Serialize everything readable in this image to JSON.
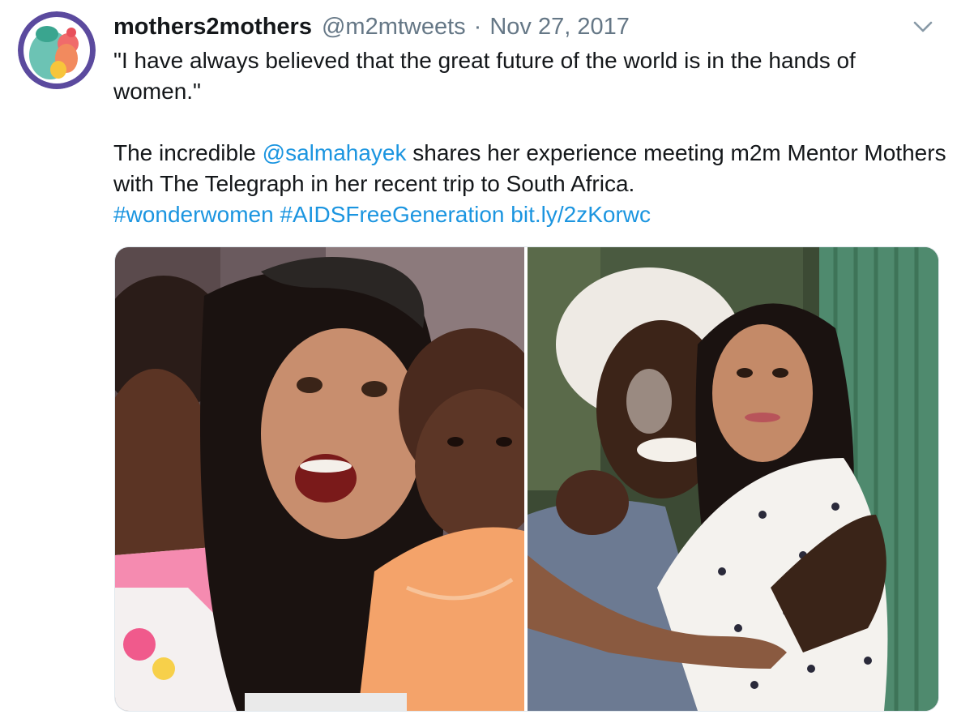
{
  "tweet": {
    "author": {
      "display_name": "mothers2mothers",
      "handle": "@m2mtweets",
      "avatar_icon": "mothers2mothers-logo"
    },
    "separator": "·",
    "date": "Nov 27, 2017",
    "menu_icon": "chevron-down-icon",
    "quote_line": "\"I have always believed that the great future of the world is in the hands of women.\"",
    "body": {
      "prefix": "The incredible ",
      "mention": "@salmahayek",
      "suffix": " shares her experience meeting m2m Mentor Mothers with The Telegraph in her recent trip to South Africa."
    },
    "hashtags": [
      "#wonderwomen",
      "#AIDSFreeGeneration"
    ],
    "link": "bit.ly/2zKorwc",
    "colors": {
      "link": "#1b95e0",
      "secondary_text": "#657786",
      "primary_text": "#14171a"
    },
    "media": [
      {
        "description_icon": "photo-woman-with-two-children"
      },
      {
        "description_icon": "photo-two-women-hugging"
      }
    ]
  }
}
